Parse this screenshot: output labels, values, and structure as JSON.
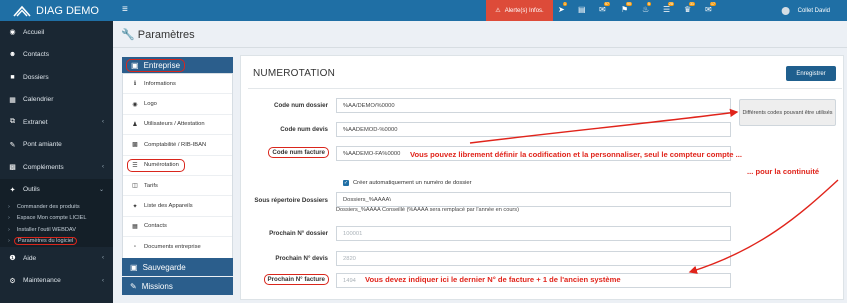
{
  "app": {
    "title": "DIAG DEMO"
  },
  "colors": {
    "brand": "#1f6fa5",
    "sidebar": "#1a2733",
    "alert": "#dd4b39",
    "annotation": "#e0241b"
  },
  "sidebar": {
    "items": [
      {
        "label": "Accueil",
        "icon": "dashboard-icon"
      },
      {
        "label": "Contacts",
        "icon": "user-icon"
      },
      {
        "label": "Dossiers",
        "icon": "folder-icon"
      },
      {
        "label": "Calendrier",
        "icon": "calendar-icon"
      },
      {
        "label": "Extranet",
        "icon": "external-icon"
      },
      {
        "label": "Pont amiante",
        "icon": "pencil-icon"
      },
      {
        "label": "Compléments",
        "icon": "chart-icon"
      },
      {
        "label": "Outils",
        "icon": "wrench-icon"
      }
    ],
    "subitems": [
      {
        "label": "Commander des produits"
      },
      {
        "label": "Espace Mon compte LICIEL"
      },
      {
        "label": "Installer l'outil WEBDAV"
      },
      {
        "label": "Paramètres du logiciel"
      }
    ],
    "bottom_items": [
      {
        "label": "Aide",
        "icon": "info-icon"
      },
      {
        "label": "Maintenance",
        "icon": "gear-icon"
      }
    ]
  },
  "topbar": {
    "alert_label": "Alerte(s) Infos.",
    "user_name": "Collet David",
    "icons": [
      {
        "icon": "rocket-icon",
        "badge": "1"
      },
      {
        "icon": "list-icon",
        "badge": ""
      },
      {
        "icon": "mail-icon",
        "badge": "57"
      },
      {
        "icon": "flag-icon",
        "badge": "90"
      },
      {
        "icon": "bell-icon",
        "badge": "5"
      },
      {
        "icon": "tasks-icon",
        "badge": "28"
      },
      {
        "icon": "trophy-icon",
        "badge": "31"
      },
      {
        "icon": "mail-open-icon",
        "badge": "17"
      }
    ]
  },
  "page": {
    "title": "Paramètres"
  },
  "left_panel": {
    "header": "Entreprise",
    "items": [
      {
        "label": "Informations",
        "icon": "info-icon"
      },
      {
        "label": "Logo",
        "icon": "circle-icon"
      },
      {
        "label": "Utilisateurs / Attestation",
        "icon": "users-icon"
      },
      {
        "label": "Comptabilité / RIB-IBAN",
        "icon": "bank-icon"
      },
      {
        "label": "Numérotation",
        "icon": "list-ol-icon"
      },
      {
        "label": "Tarifs",
        "icon": "money-icon"
      },
      {
        "label": "Liste des Appareils",
        "icon": "tool-icon"
      },
      {
        "label": "Contacts",
        "icon": "contact-icon"
      },
      {
        "label": "Documents entreprise",
        "icon": "document-icon"
      }
    ],
    "sauvegarde": "Sauvegarde",
    "missions": "Missions"
  },
  "form": {
    "title": "NUMEROTATION",
    "save_label": "Enregistrer",
    "code_dossier_label": "Code num dossier",
    "code_dossier_value": "%AA/DEMO/%0000",
    "code_devis_label": "Code num devis",
    "code_devis_value": "%AADEMOD-%0000",
    "code_facture_label": "Code num facture",
    "code_facture_value": "%AADEMO-FA%0000",
    "diff_codes_button": "Différents codes pouvant être utilisés",
    "auto_number_label": "Créer automatiquement un numéro de dossier",
    "sous_rep_label": "Sous répertoire Dossiers",
    "sous_rep_value": "Dossiers_%AAAA\\",
    "sous_rep_hint": "Dossiers_%AAAA Conseillé (%AAAA sera remplacé par l'année en cours)",
    "prochain_dossier_label": "Prochain N° dossier",
    "prochain_dossier_value": "100001",
    "prochain_devis_label": "Prochain N° devis",
    "prochain_devis_value": "2820",
    "prochain_facture_label": "Prochain N° facture",
    "prochain_facture_value": "1494"
  },
  "annotations": {
    "line1": "Vous pouvez librement définir la codification et la personnaliser, seul le compteur compte ...",
    "line2": "... pour la continuité",
    "line3": "Vous devez indiquer ici le dernier N° de facture + 1 de l'ancien système"
  }
}
